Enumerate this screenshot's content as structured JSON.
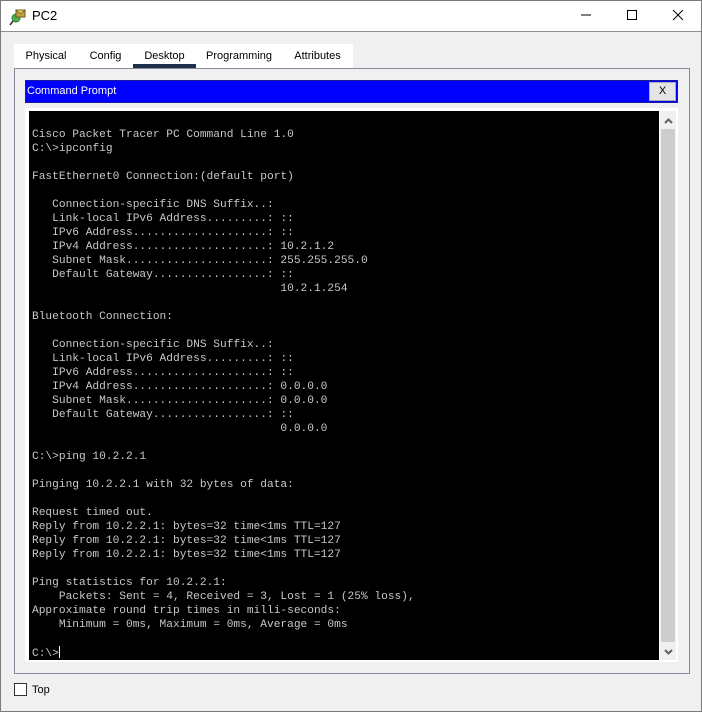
{
  "window": {
    "title": "PC2",
    "app_icon": "packet-tracer-pc-icon",
    "controls": {
      "minimize_icon": "minimize-icon",
      "maximize_icon": "maximize-icon",
      "close_icon": "close-icon"
    }
  },
  "tabs": [
    {
      "label": "Physical",
      "active": false
    },
    {
      "label": "Config",
      "active": false
    },
    {
      "label": "Desktop",
      "active": true
    },
    {
      "label": "Programming",
      "active": false
    },
    {
      "label": "Attributes",
      "active": false
    }
  ],
  "command_prompt": {
    "title": "Command Prompt",
    "close_label": "X",
    "header_color": "#0000ff",
    "lines": [
      "Cisco Packet Tracer PC Command Line 1.0",
      "C:\\>ipconfig",
      "",
      "FastEthernet0 Connection:(default port)",
      "",
      "   Connection-specific DNS Suffix..: ",
      "   Link-local IPv6 Address.........: ::",
      "   IPv6 Address....................: ::",
      "   IPv4 Address....................: 10.2.1.2",
      "   Subnet Mask.....................: 255.255.255.0",
      "   Default Gateway.................: ::",
      "                                     10.2.1.254",
      "",
      "Bluetooth Connection:",
      "",
      "   Connection-specific DNS Suffix..: ",
      "   Link-local IPv6 Address.........: ::",
      "   IPv6 Address....................: ::",
      "   IPv4 Address....................: 0.0.0.0",
      "   Subnet Mask.....................: 0.0.0.0",
      "   Default Gateway.................: ::",
      "                                     0.0.0.0",
      "",
      "C:\\>ping 10.2.2.1",
      "",
      "Pinging 10.2.2.1 with 32 bytes of data:",
      "",
      "Request timed out.",
      "Reply from 10.2.2.1: bytes=32 time<1ms TTL=127",
      "Reply from 10.2.2.1: bytes=32 time<1ms TTL=127",
      "Reply from 10.2.2.1: bytes=32 time<1ms TTL=127",
      "",
      "Ping statistics for 10.2.2.1:",
      "    Packets: Sent = 4, Received = 3, Lost = 1 (25% loss),",
      "Approximate round trip times in milli-seconds:",
      "    Minimum = 0ms, Maximum = 0ms, Average = 0ms",
      ""
    ],
    "prompt": "C:\\>"
  },
  "footer": {
    "top_checkbox_label": "Top",
    "top_checked": false
  }
}
